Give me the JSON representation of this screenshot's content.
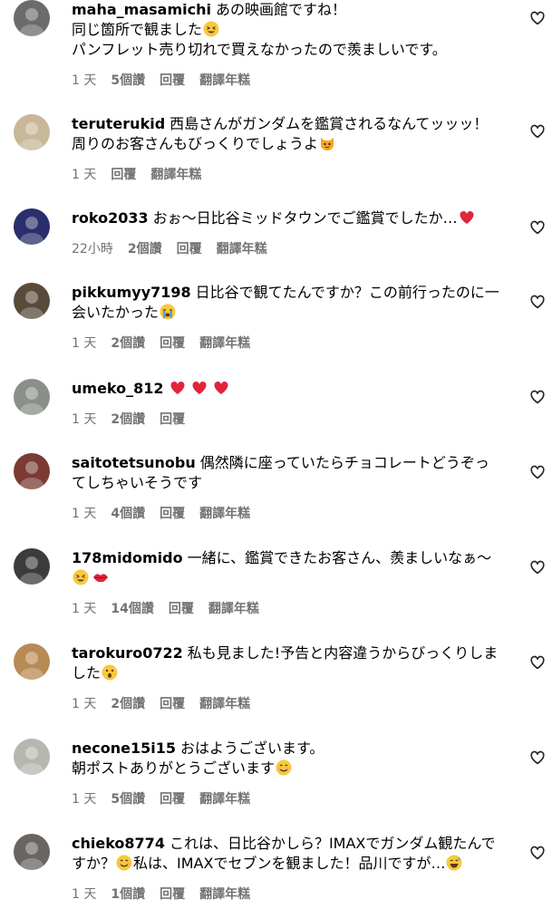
{
  "comments": [
    {
      "username": "maha_masamichi",
      "text": "あの映画館ですね！\n同じ箇所で観ました",
      "text_after": "\nパンフレット売り切れで買えなかったので羨ましいです。",
      "emoji": "laughing-emoji",
      "time": "1 天",
      "likes": "5個讚",
      "reply": "回覆",
      "translate": "翻譯年糕",
      "avatar_color": "#6b6b6b"
    },
    {
      "username": "teruterukid",
      "text": "西島さんがガンダムを鑑賞されるなんてッッッ！\n周りのお客さんもびっくりでしょうよ",
      "text_after": "",
      "emoji": "cat-emoji",
      "time": "1 天",
      "likes": "",
      "reply": "回覆",
      "translate": "翻譯年糕",
      "avatar_color": "#c9b79a"
    },
    {
      "username": "roko2033",
      "text": "おぉ～日比谷ミッドタウンでご鑑賞でしたか…",
      "text_after": "",
      "emoji": "red-heart-emoji",
      "time": "22小時",
      "likes": "2個讚",
      "reply": "回覆",
      "translate": "翻譯年糕",
      "avatar_color": "#2a2f6b"
    },
    {
      "username": "pikkumyy7198",
      "text": "日比谷で観てたんですか？この前行ったのに一\n会いたかった",
      "text_after": "",
      "emoji": "crying-emoji",
      "time": "1 天",
      "likes": "2個讚",
      "reply": "回覆",
      "translate": "翻譯年糕",
      "avatar_color": "#5a4a3a"
    },
    {
      "username": "umeko_812",
      "text": "",
      "text_after": "",
      "emoji": "three-hearts-emoji",
      "time": "1 天",
      "likes": "2個讚",
      "reply": "回覆",
      "translate": "",
      "avatar_color": "#8a8f8a"
    },
    {
      "username": "saitotetsunobu",
      "text": "偶然隣に座っていたらチョコレートどうぞっ\nてしちゃいそうです",
      "text_after": "",
      "emoji": "",
      "time": "1 天",
      "likes": "4個讚",
      "reply": "回覆",
      "translate": "翻譯年糕",
      "avatar_color": "#7a3b35"
    },
    {
      "username": "178midomido",
      "text": "一緒に、鑑賞できたお客さん、羨ましいなぁ～\n",
      "text_after": "",
      "emoji": "laughing-and-lips-emoji",
      "time": "1 天",
      "likes": "14個讚",
      "reply": "回覆",
      "translate": "翻譯年糕",
      "avatar_color": "#3c3c3c"
    },
    {
      "username": "tarokuro0722",
      "text": "私も見ました!予告と内容違うからびっくりしま\nした",
      "text_after": "",
      "emoji": "surprised-emoji",
      "time": "1 天",
      "likes": "2個讚",
      "reply": "回覆",
      "translate": "翻譯年糕",
      "avatar_color": "#b88a55"
    },
    {
      "username": "necone15i15",
      "text": "おはようございます。\n朝ポストありがとうございます",
      "text_after": "",
      "emoji": "smile-emoji",
      "time": "1 天",
      "likes": "5個讚",
      "reply": "回覆",
      "translate": "翻譯年糕",
      "avatar_color": "#b7b7b0"
    },
    {
      "username": "chieko8774",
      "text": "これは、日比谷かしら？IMAXでガンダム観たんで\nすか？",
      "text_after": "私は、IMAXでセブンを観ました！品川ですが…",
      "emoji": "smile-emoji",
      "emoji2": "grin-sweat-emoji",
      "time": "1 天",
      "likes": "1個讚",
      "reply": "回覆",
      "translate": "翻譯年糕",
      "avatar_color": "#6a6560"
    }
  ],
  "colors": {
    "meta": "#737373",
    "heart_outline": "#262626",
    "red": "#e0243a"
  }
}
